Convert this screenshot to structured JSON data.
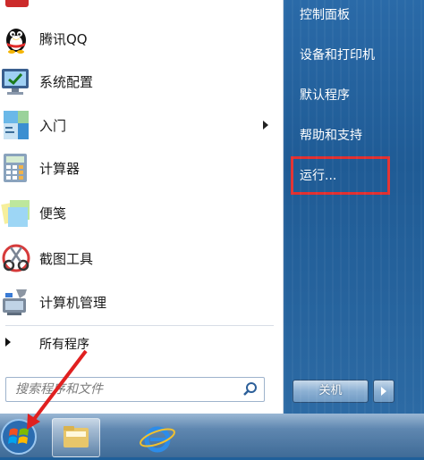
{
  "programs": [
    {
      "label": "腾讯QQ",
      "icon": "qq-icon"
    },
    {
      "label": "系统配置",
      "icon": "system-config-icon"
    },
    {
      "label": "入门",
      "icon": "getting-started-icon",
      "submenu": true
    },
    {
      "label": "计算器",
      "icon": "calculator-icon"
    },
    {
      "label": "便笺",
      "icon": "sticky-notes-icon"
    },
    {
      "label": "截图工具",
      "icon": "snipping-tool-icon"
    },
    {
      "label": "计算机管理",
      "icon": "computer-management-icon"
    }
  ],
  "all_programs_label": "所有程序",
  "search": {
    "placeholder": "搜索程序和文件"
  },
  "right_links": [
    {
      "label": "控制面板"
    },
    {
      "label": "设备和打印机"
    },
    {
      "label": "默认程序"
    },
    {
      "label": "帮助和支持"
    },
    {
      "label": "运行..."
    }
  ],
  "highlight_color": "#e23030",
  "shutdown_label": "关机"
}
